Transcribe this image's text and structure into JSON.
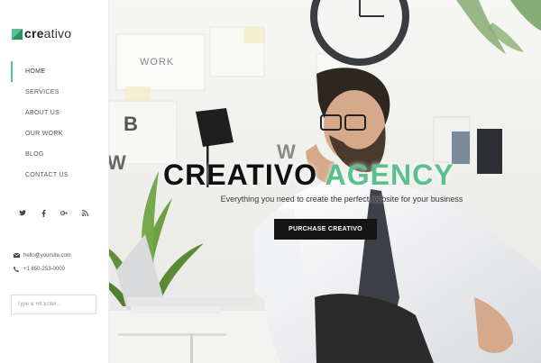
{
  "brand": {
    "logo_bold": "cre",
    "logo_light": "ativo",
    "accent_color": "#5ac18e"
  },
  "nav": {
    "items": [
      {
        "label": "HOME",
        "active": true
      },
      {
        "label": "SERVICES"
      },
      {
        "label": "ABOUT US"
      },
      {
        "label": "OUR WORK"
      },
      {
        "label": "BLOG"
      },
      {
        "label": "CONTACT US"
      }
    ]
  },
  "social": [
    "twitter-icon",
    "facebook-icon",
    "google-plus-icon",
    "rss-icon"
  ],
  "contact": {
    "email": "hello@yoursite.com",
    "phone": "+1 650-253-0000"
  },
  "search": {
    "placeholder": "Type & Hit Enter..."
  },
  "hero": {
    "title_main": "CREATIVO",
    "title_accent": "AGENCY",
    "subtitle": "Everything you need to create the perfect website for your business",
    "cta_label": "PURCHASE CREATIVO",
    "wall_text_work": "WORK"
  }
}
